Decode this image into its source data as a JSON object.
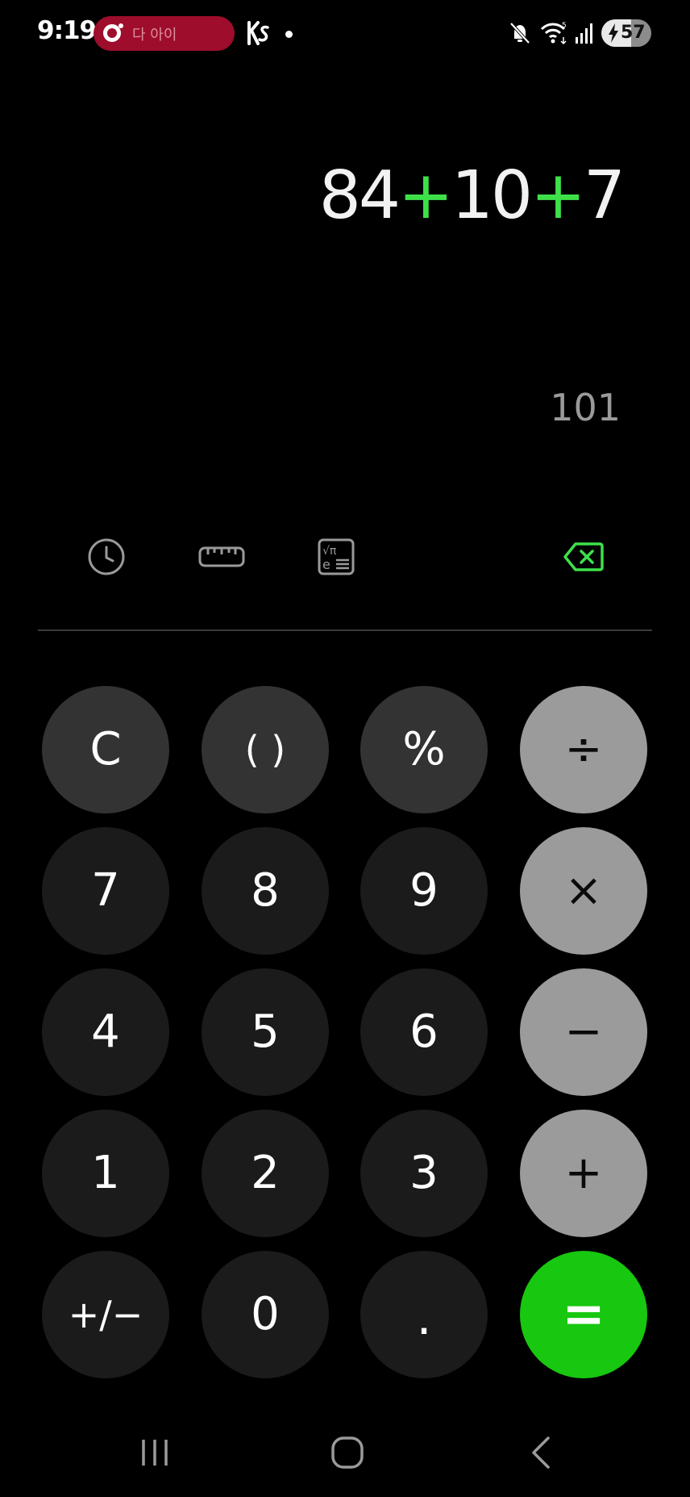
{
  "status_bar": {
    "time": "9:19",
    "notification_text": "다   아이",
    "battery_level": "57",
    "icons": [
      "notification-app-icon",
      "ks-app-icon",
      "dot",
      "mute-icon",
      "wifi-icon",
      "signal-icon",
      "battery-icon"
    ]
  },
  "display": {
    "expression_parts": [
      "84",
      "+",
      "10",
      "+",
      "7"
    ],
    "result_preview": "101"
  },
  "tools": {
    "history_icon": "clock-icon",
    "unit_converter_icon": "ruler-icon",
    "scientific_icon": "scientific-mode-icon",
    "backspace_icon": "backspace-icon"
  },
  "keypad": {
    "clear": "C",
    "parentheses": "( )",
    "percent": "%",
    "divide": "÷",
    "seven": "7",
    "eight": "8",
    "nine": "9",
    "multiply": "×",
    "four": "4",
    "five": "5",
    "six": "6",
    "minus": "−",
    "one": "1",
    "two": "2",
    "three": "3",
    "plus": "+",
    "negate": "+/−",
    "zero": "0",
    "decimal": ".",
    "equals": "="
  },
  "nav_bar": {
    "icons": [
      "recent-apps-icon",
      "home-icon",
      "back-icon"
    ]
  },
  "colors": {
    "background": "#000000",
    "accent_green": "#18c710",
    "operator_text_green": "#3ee04a",
    "key_dark": "#1b1b1b",
    "key_mid": "#333333",
    "key_light": "#9b9b9b",
    "notification_pill": "#9e0d2b"
  }
}
